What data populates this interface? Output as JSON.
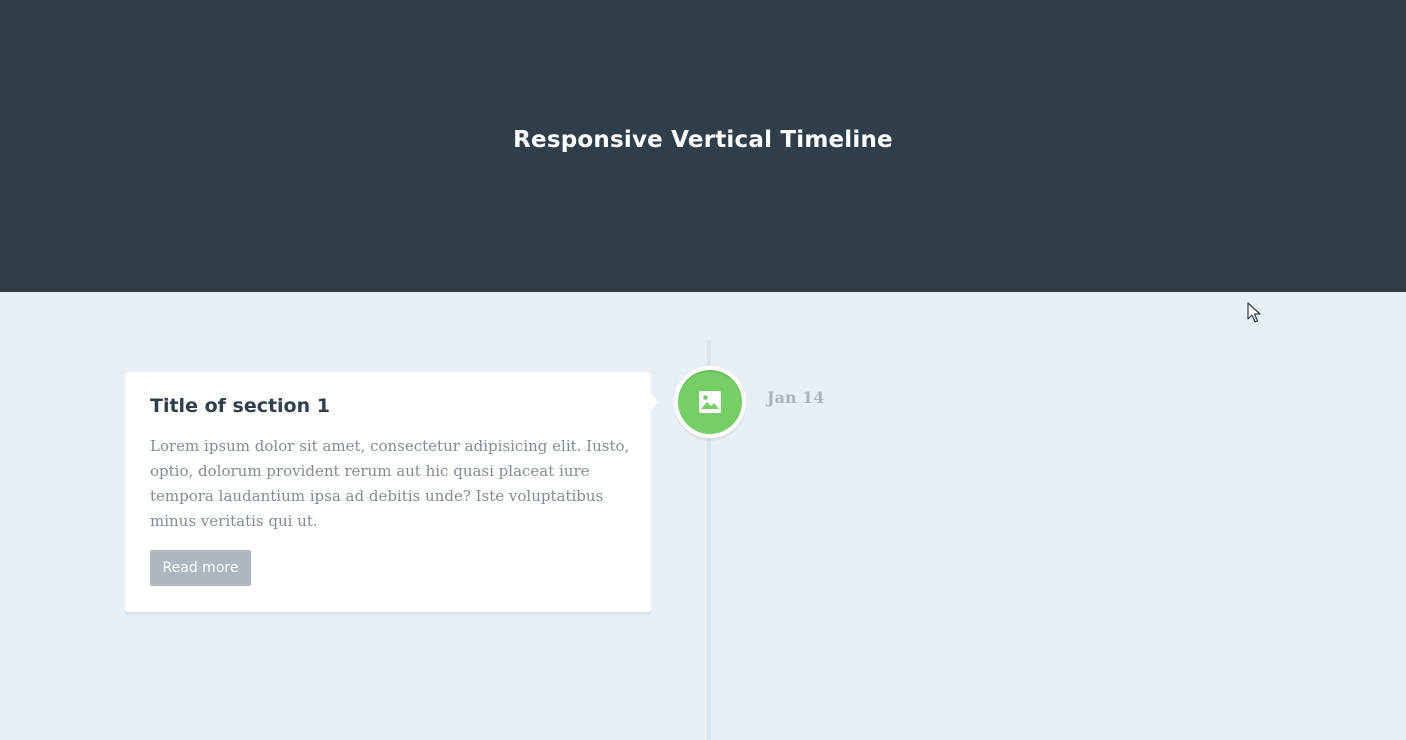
{
  "header": {
    "title": "Responsive Vertical Timeline"
  },
  "timeline": {
    "items": [
      {
        "icon": "picture-icon",
        "icon_color": "#75ce66",
        "title": "Title of section 1",
        "text": "Lorem ipsum dolor sit amet, consectetur adipisicing elit. Iusto, optio, dolorum provident rerum aut hic quasi placeat iure tempora laudantium ipsa ad debitis unde? Iste voluptatibus minus veritatis qui ut.",
        "button_label": "Read more",
        "date": "Jan 14"
      }
    ]
  },
  "colors": {
    "header_bg": "#303e49",
    "page_bg": "#e9f0f5",
    "button_bg": "#acb7c0"
  }
}
